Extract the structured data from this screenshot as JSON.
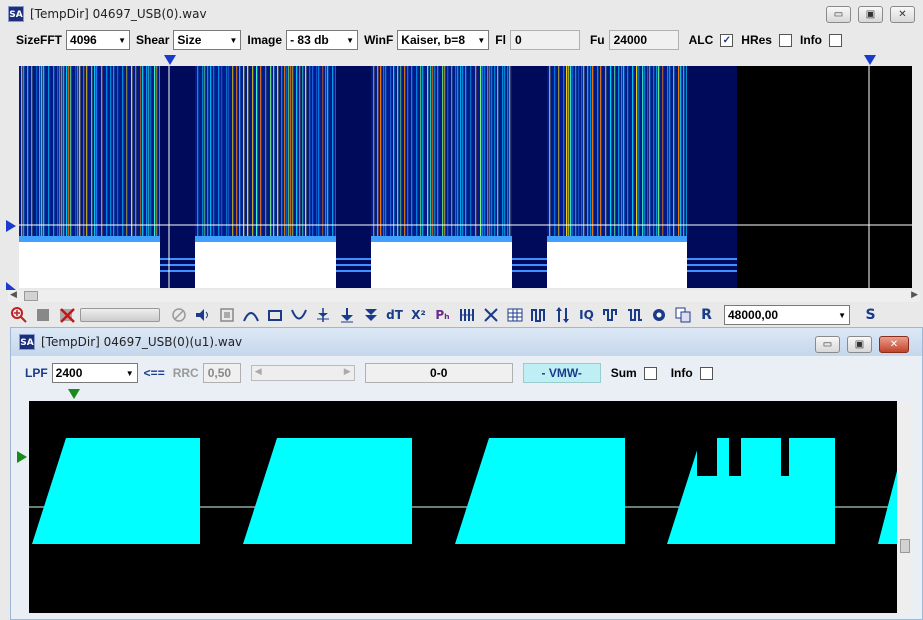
{
  "main_window": {
    "title": "[TempDir] 04697_USB(0).wav",
    "logo_text": "SA",
    "controls": {
      "minimize": "▭",
      "maximize": "▣",
      "close": "✕"
    }
  },
  "toolbar": {
    "sizefft_label": "SizeFFT",
    "sizefft_value": "4096",
    "shear_label": "Shear",
    "shear_value": "Size",
    "image_label": "Image",
    "image_value": "- 83 db",
    "winf_label": "WinF",
    "winf_value": "Kaiser, b=8",
    "fl_label": "Fl",
    "fl_value": "0",
    "fu_label": "Fu",
    "fu_value": "24000",
    "alc_label": "ALC",
    "alc_checked": "✓",
    "hres_label": "HRes",
    "info_label": "Info"
  },
  "icon_toolbar": {
    "icons": [
      "zoom-in-icon",
      "stop-icon",
      "delete-icon",
      "progress-bar",
      "no-icon",
      "speaker-icon",
      "square-icon",
      "hump-icon",
      "rect-icon",
      "valley-icon",
      "filter-icon",
      "down-arrow-icon",
      "double-down-icon",
      "dt-icon",
      "x-squared-icon",
      "ph-icon",
      "comb-icon",
      "cross-icon",
      "grid-icon",
      "pulse-icon",
      "swap-icon",
      "iq-icon",
      "wave-square-icon",
      "wave-square2-icon",
      "settings-icon",
      "copy-icon",
      "r-icon"
    ],
    "dt_text": "dT",
    "x2_text": "X²",
    "ph_text": "Pₕ",
    "iq_text": "IQ",
    "r_text": "R",
    "rate_value": "48000,00",
    "s_text": "S"
  },
  "child_window": {
    "title": "[TempDir] 04697_USB(0)(u1).wav",
    "logo_text": "SA",
    "lpf_label": "LPF",
    "lpf_value": "2400",
    "arrow_label": "<==",
    "rrc_label": "RRC",
    "rrc_value": "0,50",
    "range_value": "0-0",
    "vmw_label": "- VMW-",
    "sum_label": "Sum",
    "info_label": "Info"
  },
  "colors": {
    "accent": "#1a3a8a",
    "waveform": "#00ffff",
    "spectrogram_bg": "#000080",
    "marker_blue": "#1a3ad0",
    "marker_green": "#1a8a1a"
  }
}
